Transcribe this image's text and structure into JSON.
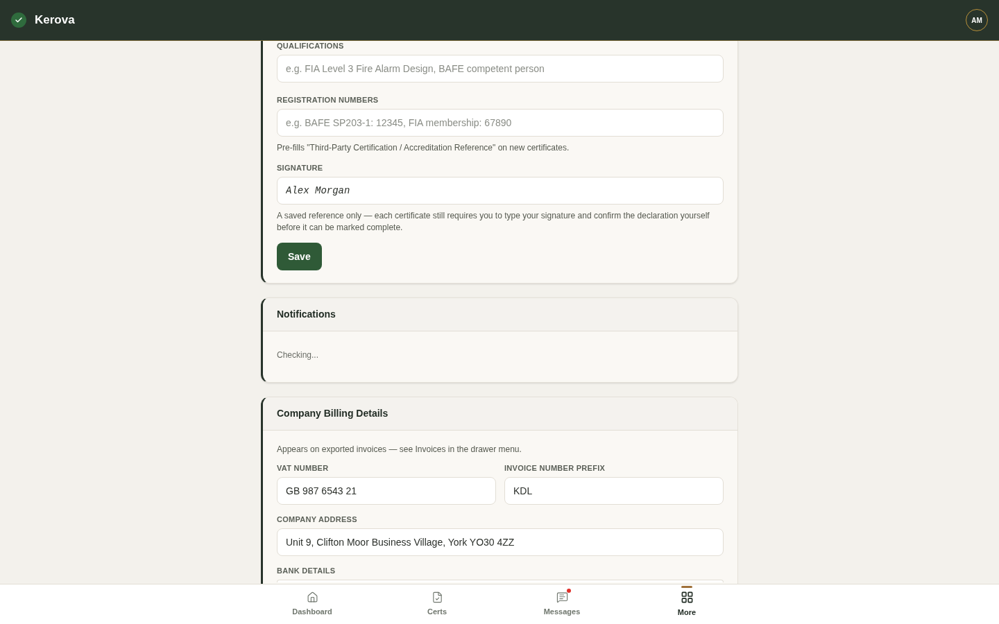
{
  "app": {
    "name": "Kerova",
    "avatar": "AM"
  },
  "profile": {
    "fields": [
      {
        "label": "QUALIFICATIONS",
        "placeholder": "e.g. FIA Level 3 Fire Alarm Design, BAFE competent person",
        "kind": "text"
      },
      {
        "label": "REGISTRATION NUMBERS",
        "placeholder": "e.g. BAFE SP203-1: 12345, FIA membership: 67890",
        "kind": "text",
        "help": "Pre-fills \"Third-Party Certification / Accreditation Reference\" on new certificates."
      },
      {
        "label": "SIGNATURE",
        "value": "Alex Morgan",
        "kind": "signature",
        "help": "A saved reference only — each certificate still requires you to type your signature and confirm the declaration yourself before it can be marked complete."
      }
    ],
    "save_button": "Save"
  },
  "notifications": {
    "title": "Notifications",
    "status": "Checking..."
  },
  "billing": {
    "title": "Company Billing Details",
    "note": "Appears on exported invoices — see Invoices in the drawer menu.",
    "fields": [
      {
        "label": "VAT NUMBER",
        "value": "GB 987 6543 21",
        "half": true
      },
      {
        "label": "INVOICE NUMBER PREFIX",
        "value": "KDL",
        "half": true
      },
      {
        "label": "COMPANY ADDRESS",
        "value": "Unit 9, Clifton Moor Business Village, York YO30 4ZZ",
        "half": false
      },
      {
        "label": "BANK DETAILS",
        "half": false
      }
    ]
  },
  "bottom_nav": [
    {
      "label": "Dashboard",
      "selected": false,
      "unread": false
    },
    {
      "label": "Certs",
      "selected": false,
      "unread": false
    },
    {
      "label": "Messages",
      "selected": false,
      "unread": true
    },
    {
      "label": "More",
      "selected": true,
      "unread": false
    }
  ]
}
